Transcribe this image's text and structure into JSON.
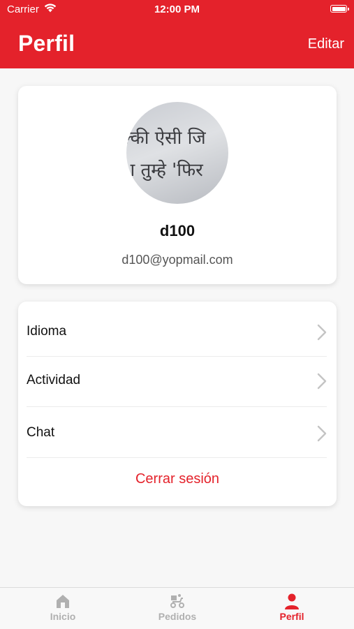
{
  "status_bar": {
    "carrier": "Carrier",
    "time": "12:00 PM"
  },
  "header": {
    "title": "Perfil",
    "edit_label": "Editar"
  },
  "profile": {
    "avatar_text_line1": "ल्की ऐसी जि",
    "avatar_text_line2": "ा तुम्हे 'फिर",
    "username": "d100",
    "email": "d100@yopmail.com"
  },
  "menu": {
    "items": [
      {
        "label": "Idioma"
      },
      {
        "label": "Actividad"
      },
      {
        "label": "Chat"
      }
    ],
    "logout_label": "Cerrar sesión"
  },
  "tabbar": {
    "tabs": [
      {
        "label": "Inicio",
        "icon": "home-icon",
        "active": false
      },
      {
        "label": "Pedidos",
        "icon": "delivery-scooter-icon",
        "active": false
      },
      {
        "label": "Perfil",
        "icon": "person-icon",
        "active": true
      }
    ]
  },
  "colors": {
    "accent": "#e4222b",
    "inactive_tab": "#b0b0b0"
  }
}
